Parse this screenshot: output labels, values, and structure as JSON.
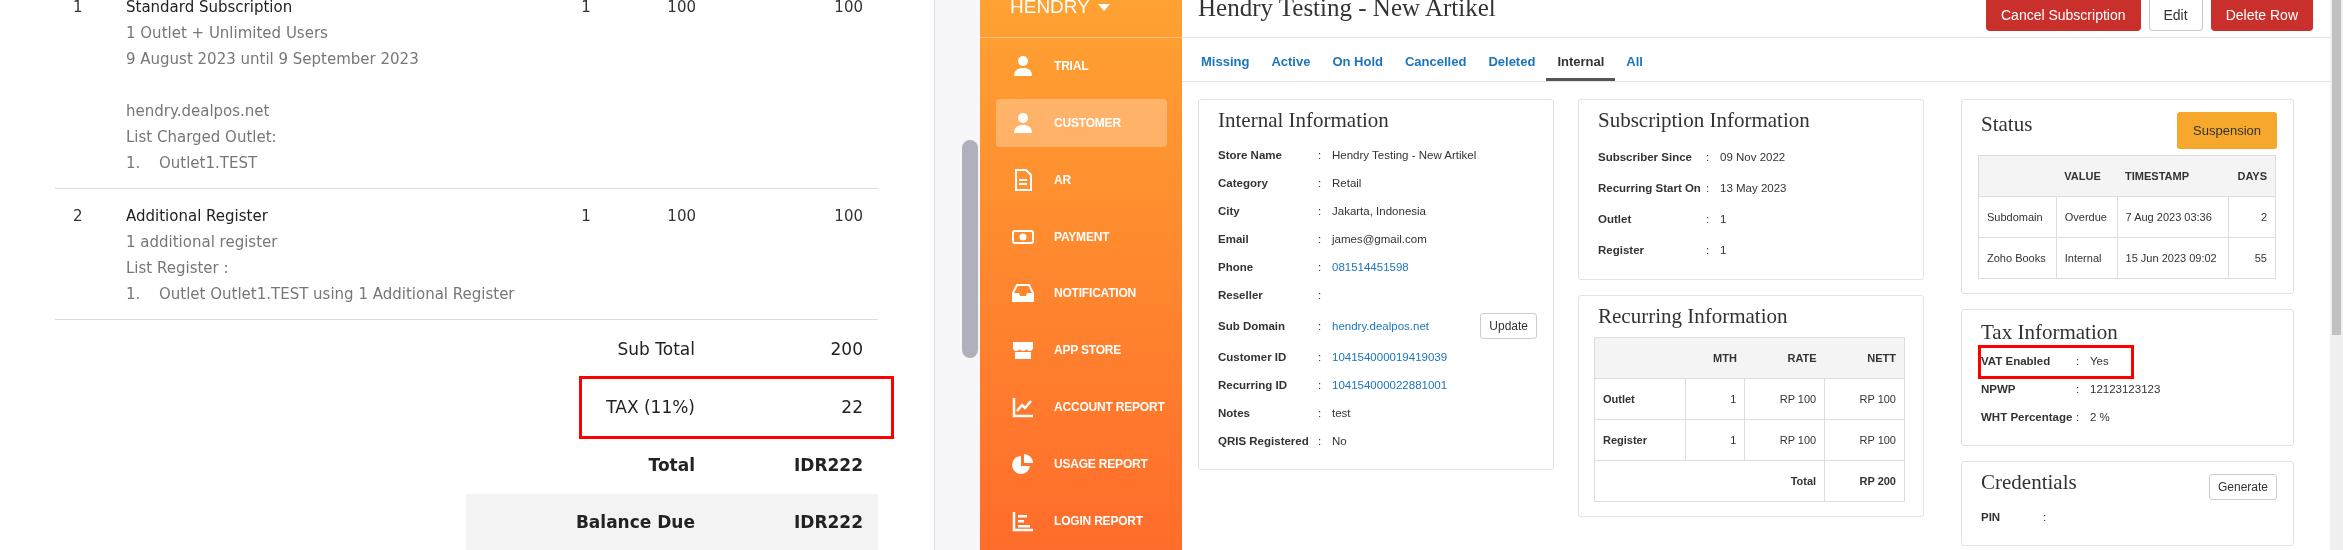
{
  "invoice": {
    "items": [
      {
        "number": "1",
        "name": "Standard Subscription",
        "qty": "1",
        "price": "100",
        "amount": "100",
        "blocks": [
          [
            "1 Outlet + Unlimited Users",
            "9 August 2023 until 9 September 2023"
          ],
          [
            "hendry.dealpos.net",
            "List Charged Outlet:"
          ]
        ],
        "list": [
          {
            "marker": "1.",
            "text": "Outlet1.TEST"
          }
        ]
      },
      {
        "number": "2",
        "name": "Additional Register",
        "qty": "1",
        "price": "100",
        "amount": "100",
        "blocks": [
          [
            "1 additional register",
            "List Register :"
          ]
        ],
        "list": [
          {
            "marker": "1.",
            "text": "Outlet Outlet1.TEST using 1 Additional Register"
          }
        ]
      }
    ],
    "totals": [
      {
        "label": "Sub Total",
        "value": "200",
        "kind": "plain",
        "highlighted": false
      },
      {
        "label": "TAX (11%)",
        "value": "22",
        "kind": "plain",
        "highlighted": true
      },
      {
        "label": "Total",
        "value": "IDR222",
        "kind": "bold",
        "highlighted": false
      },
      {
        "label": "Balance Due",
        "value": "IDR222",
        "kind": "due",
        "highlighted": false
      }
    ]
  },
  "sidebar": {
    "user": "HENDRY",
    "items": [
      {
        "label": "TRIAL",
        "selected": false
      },
      {
        "label": "CUSTOMER",
        "selected": true
      },
      {
        "label": "AR",
        "selected": false
      },
      {
        "label": "PAYMENT",
        "selected": false
      },
      {
        "label": "NOTIFICATION",
        "selected": false
      },
      {
        "label": "APP STORE",
        "selected": false
      },
      {
        "label": "ACCOUNT REPORT",
        "selected": false
      },
      {
        "label": "USAGE REPORT",
        "selected": false
      },
      {
        "label": "LOGIN REPORT",
        "selected": false
      }
    ]
  },
  "header": {
    "title": "Hendry Testing - New Artikel",
    "buttons": [
      {
        "label": "Cancel Subscription",
        "kind": "danger"
      },
      {
        "label": "Edit",
        "kind": "default"
      },
      {
        "label": "Delete Row",
        "kind": "danger"
      }
    ]
  },
  "tabs": [
    {
      "label": "Missing",
      "selected": false
    },
    {
      "label": "Active",
      "selected": false
    },
    {
      "label": "On Hold",
      "selected": false
    },
    {
      "label": "Cancelled",
      "selected": false
    },
    {
      "label": "Deleted",
      "selected": false
    },
    {
      "label": "Internal",
      "selected": true
    },
    {
      "label": "All",
      "selected": false
    }
  ],
  "internal_information": {
    "title": "Internal Information",
    "fields": [
      {
        "label": "Store Name",
        "colon": ":",
        "value": "Hendry Testing - New Artikel",
        "kind": "text"
      },
      {
        "label": "Category",
        "colon": ":",
        "value": "Retail",
        "kind": "text"
      },
      {
        "label": "City",
        "colon": ":",
        "value": "Jakarta, Indonesia",
        "kind": "text"
      },
      {
        "label": "Email",
        "colon": ":",
        "value": "james@gmail.com",
        "kind": "text"
      },
      {
        "label": "Phone",
        "colon": ":",
        "value": "081514451598",
        "kind": "link"
      },
      {
        "label": "Reseller",
        "colon": ":"
      },
      {
        "label": "Sub Domain",
        "colon": ":",
        "value": "hendry.dealpos.net",
        "kind": "link",
        "button": "Update"
      },
      {
        "label": "Customer ID",
        "colon": ":",
        "value": "104154000019419039",
        "kind": "link"
      },
      {
        "label": "Recurring ID",
        "colon": ":",
        "value": "104154000022881001",
        "kind": "link"
      },
      {
        "label": "Notes",
        "colon": ":",
        "value": "test",
        "kind": "text"
      },
      {
        "label": "QRIS Registered",
        "colon": ":",
        "value": "No",
        "kind": "text"
      }
    ]
  },
  "subscription_information": {
    "title": "Subscription Information",
    "fields": [
      {
        "label": "Subscriber Since",
        "colon": ":",
        "value": "09 Nov 2022"
      },
      {
        "label": "Recurring Start On",
        "colon": ":",
        "value": "13 May 2023"
      },
      {
        "label": "Outlet",
        "colon": ":",
        "value": "1"
      },
      {
        "label": "Register",
        "colon": ":",
        "value": "1"
      }
    ]
  },
  "recurring_information": {
    "title": "Recurring Information",
    "columns": [
      "MTH",
      "RATE",
      "NETT"
    ],
    "rows": [
      {
        "label": "Outlet",
        "mth": "1",
        "rate": "RP 100",
        "nett": "RP 100"
      },
      {
        "label": "Register",
        "mth": "1",
        "rate": "RP 100",
        "nett": "RP 100"
      }
    ],
    "total": {
      "label": "Total",
      "value": "RP 200"
    }
  },
  "status": {
    "title": "Status",
    "button": "Suspension",
    "columns": [
      "VALUE",
      "TIMESTAMP",
      "DAYS"
    ],
    "rows": [
      {
        "name": "Subdomain",
        "value": "Overdue",
        "timestamp": "7 Aug 2023 03:36",
        "days": "2"
      },
      {
        "name": "Zoho Books",
        "value": "Internal",
        "timestamp": "15 Jun 2023 09:02",
        "days": "55"
      }
    ]
  },
  "tax_information": {
    "title": "Tax Information",
    "fields": [
      {
        "label": "VAT Enabled",
        "colon": ":",
        "value": "Yes",
        "highlighted": true
      },
      {
        "label": "NPWP",
        "colon": ":",
        "value": "12123123123",
        "highlighted": false
      },
      {
        "label": "WHT Percentage",
        "colon": ":",
        "value": "2 %",
        "highlighted": false
      }
    ]
  },
  "credentials": {
    "title": "Credentials",
    "button": "Generate",
    "fields": [
      {
        "label": "PIN",
        "colon": ":"
      }
    ]
  }
}
